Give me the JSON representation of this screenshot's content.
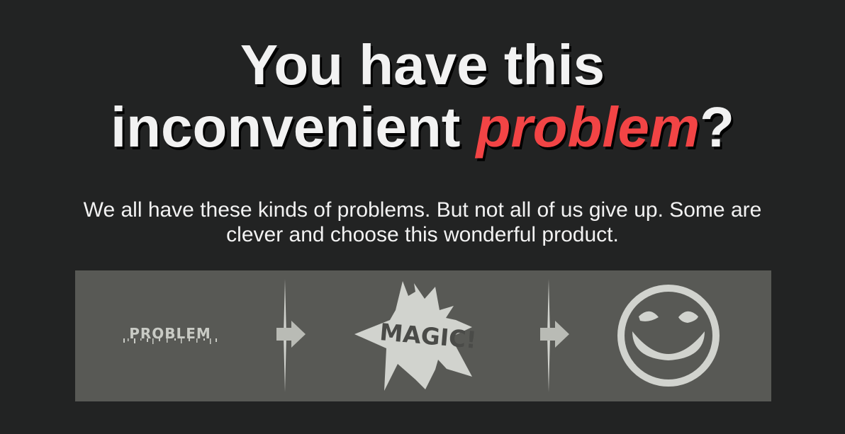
{
  "headline": {
    "line1": "You have this",
    "line2_before": "inconvenient ",
    "line2_accent": "problem",
    "line2_after": "?"
  },
  "subtext": "We all have these kinds of problems. But not all of us give up. Some are clever and choose this wonderful product.",
  "illustration": {
    "problem_label": "PROBLEM",
    "magic_label": "MAGIC!",
    "smiley_icon": "smiley-face-icon",
    "arrow_icon": "right-arrow-icon"
  },
  "colors": {
    "background": "#222323",
    "text": "#f2f2f2",
    "accent": "#f24445",
    "panel": "#585955",
    "graphic": "#d1d3ce"
  }
}
